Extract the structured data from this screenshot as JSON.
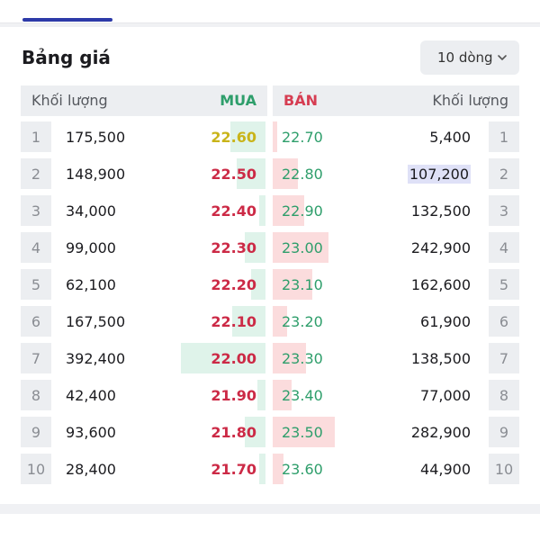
{
  "orderbook": {
    "title": "Bảng giá",
    "rows_selector": {
      "value": "10 dòng",
      "icon": "chevron-down-icon"
    },
    "headers": {
      "buy_volume": "Khối lượng",
      "buy": "MUA",
      "sell": "BÁN",
      "sell_volume": "Khối lượng"
    },
    "colors": {
      "buy_label": "#2e9e6b",
      "sell_label": "#d63d52",
      "price_up": "#2e9e6b",
      "price_down": "#cc2a46",
      "reference": "#c9b41a",
      "highlight_bg": "#dfe1f7"
    },
    "rows": [
      {
        "idx": "1",
        "bid_volume": "175,500",
        "bid_price": "22.60",
        "bid_color": "reference",
        "ask_price": "22.70",
        "ask_volume": "5,400",
        "bid_fill": 0.17,
        "ask_fill": 0.02
      },
      {
        "idx": "2",
        "bid_volume": "148,900",
        "bid_price": "22.50",
        "bid_color": "down",
        "ask_price": "22.80",
        "ask_volume": "107,200",
        "bid_fill": 0.14,
        "ask_fill": 0.12,
        "ask_highlight": true
      },
      {
        "idx": "3",
        "bid_volume": "34,000",
        "bid_price": "22.40",
        "bid_color": "down",
        "ask_price": "22.90",
        "ask_volume": "132,500",
        "bid_fill": 0.03,
        "ask_fill": 0.15
      },
      {
        "idx": "4",
        "bid_volume": "99,000",
        "bid_price": "22.30",
        "bid_color": "down",
        "ask_price": "23.00",
        "ask_volume": "242,900",
        "bid_fill": 0.1,
        "ask_fill": 0.27
      },
      {
        "idx": "5",
        "bid_volume": "62,100",
        "bid_price": "22.20",
        "bid_color": "down",
        "ask_price": "23.10",
        "ask_volume": "162,600",
        "bid_fill": 0.07,
        "ask_fill": 0.19
      },
      {
        "idx": "6",
        "bid_volume": "167,500",
        "bid_price": "22.10",
        "bid_color": "down",
        "ask_price": "23.20",
        "ask_volume": "61,900",
        "bid_fill": 0.16,
        "ask_fill": 0.07
      },
      {
        "idx": "7",
        "bid_volume": "392,400",
        "bid_price": "22.00",
        "bid_color": "down",
        "ask_price": "23.30",
        "ask_volume": "138,500",
        "bid_fill": 0.41,
        "ask_fill": 0.16
      },
      {
        "idx": "8",
        "bid_volume": "42,400",
        "bid_price": "21.90",
        "bid_color": "down",
        "ask_price": "23.40",
        "ask_volume": "77,000",
        "bid_fill": 0.04,
        "ask_fill": 0.09
      },
      {
        "idx": "9",
        "bid_volume": "93,600",
        "bid_price": "21.80",
        "bid_color": "down",
        "ask_price": "23.50",
        "ask_volume": "282,900",
        "bid_fill": 0.1,
        "ask_fill": 0.3
      },
      {
        "idx": "10",
        "bid_volume": "28,400",
        "bid_price": "21.70",
        "bid_color": "down",
        "ask_price": "23.60",
        "ask_volume": "44,900",
        "bid_fill": 0.03,
        "ask_fill": 0.05
      }
    ]
  }
}
